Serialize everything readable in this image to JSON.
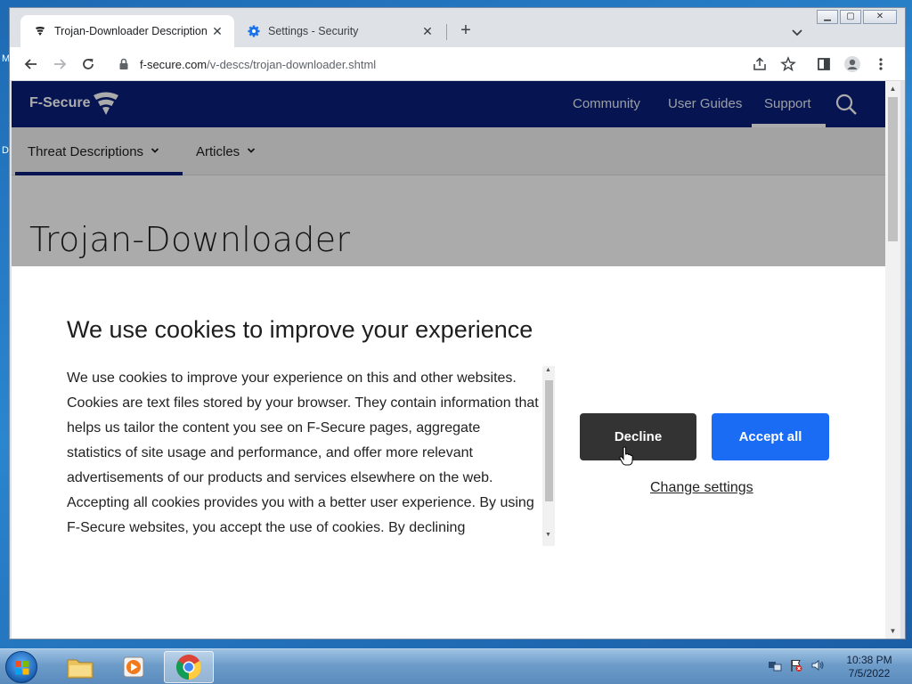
{
  "desktop": {
    "fragment_m": "M",
    "fragment_d": "D"
  },
  "browser": {
    "tabs": [
      {
        "title": "Trojan-Downloader Description |",
        "close": "✕"
      },
      {
        "title": "Settings - Security",
        "close": "✕"
      }
    ],
    "new_tab": "+",
    "address": {
      "host": "f-secure.com",
      "path": "/v-descs/trojan-downloader.shtml"
    }
  },
  "site": {
    "logo_text": "F-Secure",
    "nav": [
      "Community",
      "User Guides",
      "Support"
    ],
    "subnav": [
      "Threat Descriptions",
      "Articles"
    ],
    "page_title": "Trojan-Downloader"
  },
  "cookie": {
    "heading": "We use cookies to improve your experience",
    "body": "We use cookies to improve your experience on this and other websites. Cookies are text files stored by your browser. They contain information that helps us tailor the content you see on F-Secure pages, aggregate statistics of site usage and performance, and offer more relevant advertisements of our products and services elsewhere on the web. Accepting all cookies provides you with a better user experience. By using F-Secure websites, you accept the use of cookies. By declining",
    "decline": "Decline",
    "accept": "Accept all",
    "change": "Change settings"
  },
  "taskbar": {
    "time": "10:38 PM",
    "date": "7/5/2022"
  },
  "colors": {
    "brand_navy": "#0a1f7a",
    "accept_blue": "#1a6cf5",
    "decline_dark": "#333333"
  }
}
